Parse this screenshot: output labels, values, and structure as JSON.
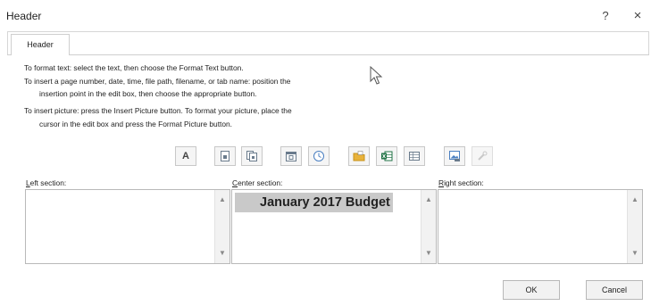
{
  "window": {
    "title": "Header",
    "help_label": "?",
    "close_label": "×"
  },
  "tabs": [
    {
      "label": "Header"
    }
  ],
  "instructions": [
    "To format text:  select the text, then choose the Format Text button.",
    "To insert a page number, date, time, file path, filename, or tab name:  position the",
    "insertion point in the edit box, then choose the appropriate button.",
    "To insert picture: press the Insert Picture button.  To format your picture, place the",
    "cursor in the edit box and press the Format Picture button."
  ],
  "toolbar": {
    "format_text_label": "A",
    "buttons": [
      {
        "name": "format-text-button",
        "icon": "format-text-icon"
      },
      {
        "name": "insert-page-number-button",
        "icon": "page-number-icon"
      },
      {
        "name": "insert-number-of-pages-button",
        "icon": "number-of-pages-icon"
      },
      {
        "name": "insert-date-button",
        "icon": "calendar-icon"
      },
      {
        "name": "insert-time-button",
        "icon": "clock-icon"
      },
      {
        "name": "insert-file-path-button",
        "icon": "folder-icon"
      },
      {
        "name": "insert-file-name-button",
        "icon": "excel-icon"
      },
      {
        "name": "insert-sheet-name-button",
        "icon": "sheet-tab-icon"
      },
      {
        "name": "insert-picture-button",
        "icon": "picture-icon"
      },
      {
        "name": "format-picture-button",
        "icon": "format-picture-icon",
        "disabled": true
      }
    ]
  },
  "sections": {
    "left": {
      "label_first": "L",
      "label_rest": "eft section:",
      "value": ""
    },
    "center": {
      "label_first": "C",
      "label_rest": "enter section:",
      "value": "January 2017 Budget"
    },
    "right": {
      "label_first": "R",
      "label_rest": "ight section:",
      "value": ""
    }
  },
  "scroll": {
    "up": "▲",
    "down": "▼"
  },
  "footer": {
    "ok_label": "OK",
    "cancel_label": "Cancel"
  },
  "colors": {
    "selection_highlight": "#c9c9c9",
    "folder_yellow": "#e8b23a",
    "excel_green": "#217346",
    "picture_blue": "#4a7fc1"
  }
}
